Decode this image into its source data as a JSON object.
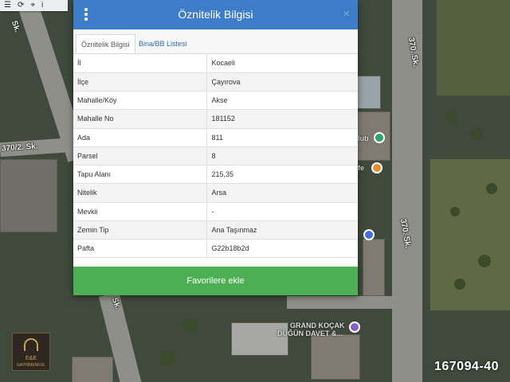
{
  "map": {
    "streets": [
      "370. Sk.",
      "370/2. Sk.",
      "370. Sk.",
      "Sk.",
      "Sk."
    ],
    "pois": [
      "GRAND KOÇAK",
      "DÜĞÜN DAVET &...",
      "lub",
      "fe"
    ],
    "photo_code": "167094-40",
    "logo_lines": [
      "E&E",
      "GAYRİMENKUL"
    ]
  },
  "panel": {
    "title": "Öznitelik Bilgisi",
    "close_label": "×",
    "tabs": [
      {
        "label": "Öznitelik Bilgisi",
        "active": true
      },
      {
        "label": "Bina/BB Listesi",
        "active": false
      }
    ],
    "rows": [
      {
        "key": "İl",
        "value": "Kocaeli"
      },
      {
        "key": "İlçe",
        "value": "Çayırova"
      },
      {
        "key": "Mahalle/Köy",
        "value": "Akse"
      },
      {
        "key": "Mahalle No",
        "value": "181152"
      },
      {
        "key": "Ada",
        "value": "811"
      },
      {
        "key": "Parsel",
        "value": "8"
      },
      {
        "key": "Tapu Alanı",
        "value": "215,35"
      },
      {
        "key": "Nitelik",
        "value": "Arsa"
      },
      {
        "key": "Mevkii",
        "value": "-"
      },
      {
        "key": "Zemin Tip",
        "value": "Ana Taşınmaz"
      },
      {
        "key": "Pafta",
        "value": "G22b18b2d"
      }
    ],
    "favorite_button": "Favorilere ekle"
  },
  "colors": {
    "header": "#3d7cc6",
    "button": "#4cb052"
  }
}
